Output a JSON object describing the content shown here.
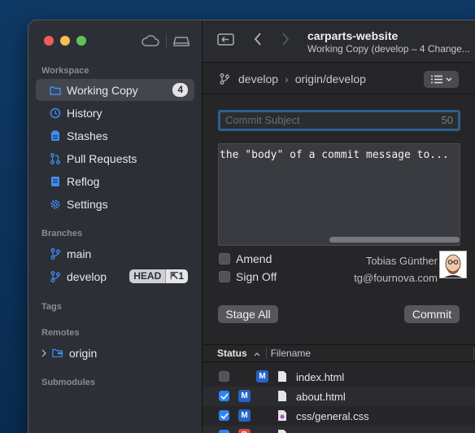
{
  "sidebar": {
    "workspace_title": "Workspace",
    "workspace_items": [
      {
        "label": "Working Copy",
        "badge": "4",
        "icon": "folder-icon"
      },
      {
        "label": "History",
        "icon": "history-icon"
      },
      {
        "label": "Stashes",
        "icon": "stash-icon"
      },
      {
        "label": "Pull Requests",
        "icon": "pull-request-icon"
      },
      {
        "label": "Reflog",
        "icon": "reflog-icon"
      },
      {
        "label": "Settings",
        "icon": "gear-icon"
      }
    ],
    "branches_title": "Branches",
    "branches": [
      {
        "label": "main"
      },
      {
        "label": "develop",
        "head_label": "HEAD",
        "ahead": "1"
      }
    ],
    "tags_title": "Tags",
    "remotes_title": "Remotes",
    "remotes": [
      {
        "label": "origin"
      }
    ],
    "submodules_title": "Submodules"
  },
  "toolbar": {
    "title": "carparts-website",
    "subtitle": "Working Copy (develop – 4 Change..."
  },
  "branchbar": {
    "local": "develop",
    "remote": "origin/develop"
  },
  "commit": {
    "subject_placeholder": "Commit Subject",
    "subject_count": "50",
    "body_text": "the \"body\" of a commit message to...",
    "amend_label": "Amend",
    "signoff_label": "Sign Off",
    "author_name": "Tobias Günther",
    "author_email": "tg@fournova.com",
    "stage_all_label": "Stage All",
    "commit_label": "Commit"
  },
  "files": {
    "col_status": "Status",
    "col_filename": "Filename",
    "rows": [
      {
        "checked": false,
        "status": "M",
        "name": "index.html"
      },
      {
        "checked": true,
        "status": "M",
        "name": "about.html"
      },
      {
        "checked": true,
        "status": "M",
        "name": "css/general.css"
      },
      {
        "checked": true,
        "status": "D",
        "name": ""
      }
    ]
  },
  "colors": {
    "accent": "#2f82f7",
    "modified_badge": "#2864c8",
    "deleted_badge": "#d94b3e"
  }
}
